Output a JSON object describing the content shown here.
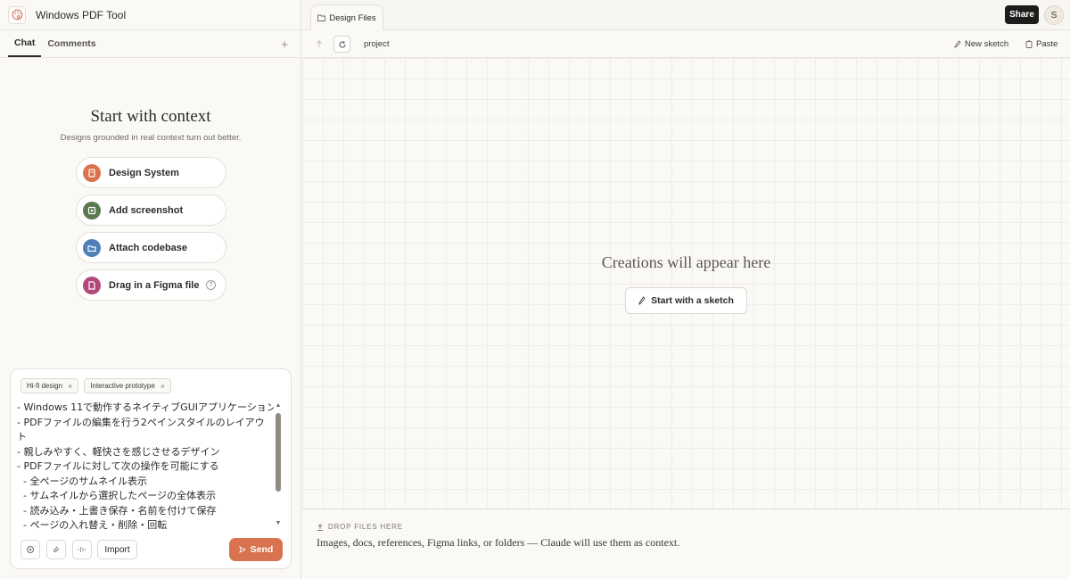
{
  "app": {
    "title": "Windows PDF Tool"
  },
  "left_tabs": {
    "chat": "Chat",
    "comments": "Comments",
    "add": "+"
  },
  "context": {
    "title": "Start with context",
    "subtitle": "Designs grounded in real context turn out better.",
    "options": [
      {
        "label": "Design System",
        "icon": "design-system-icon",
        "color": "#d9734f"
      },
      {
        "label": "Add screenshot",
        "icon": "screenshot-icon",
        "color": "#5c7a4f"
      },
      {
        "label": "Attach codebase",
        "icon": "folder-icon",
        "color": "#4f7fb8"
      },
      {
        "label": "Drag in a Figma file",
        "icon": "figma-file-icon",
        "color": "#b0497a",
        "help": "?"
      }
    ]
  },
  "composer": {
    "chips": [
      {
        "label": "Hi-fi design",
        "close": "×"
      },
      {
        "label": "Interactive prototype",
        "close": "×"
      }
    ],
    "prompt_lines": [
      "- Windows 11で動作するネイティブGUIアプリケーション",
      "- PDFファイルの編集を行う2ペインスタイルのレイアウト",
      "- 親しみやすく、軽快さを感じさせるデザイン",
      "- PDFファイルに対して次の操作を可能にする",
      "  - 全ページのサムネイル表示",
      "  - サムネイルから選択したページの全体表示",
      "  - 読み込み・上書き保存・名前を付けて保存",
      "  - ページの入れ替え・削除・回転"
    ],
    "import_label": "Import",
    "send_label": "Send"
  },
  "header": {
    "file_tab": "Design Files",
    "share_label": "Share",
    "avatar_initial": "S"
  },
  "toolbar": {
    "path": "project",
    "new_sketch": "New sketch",
    "paste": "Paste"
  },
  "canvas": {
    "empty_title": "Creations will appear here",
    "sketch_button": "Start with a sketch"
  },
  "dropzone": {
    "label": "DROP FILES HERE",
    "text": "Images, docs, references, Figma links, or folders — Claude will use them as context."
  },
  "colors": {
    "accent": "#d9734f",
    "share_bg": "#1d1c1a"
  }
}
